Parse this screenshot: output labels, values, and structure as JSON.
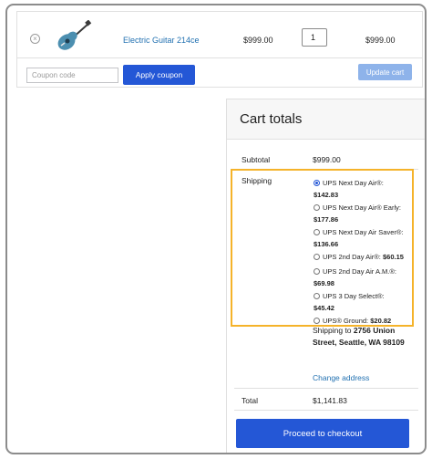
{
  "cart": {
    "remove_icon": "×",
    "product_image_icon": "guitar-thumbnail",
    "product_name": "Electric Guitar 214ce",
    "price": "$999.00",
    "quantity": "1",
    "line_subtotal": "$999.00"
  },
  "coupon": {
    "placeholder": "Coupon code",
    "apply_label": "Apply coupon",
    "update_label": "Update cart"
  },
  "totals": {
    "title": "Cart totals",
    "subtotal_label": "Subtotal",
    "subtotal_value": "$999.00",
    "shipping_label": "Shipping",
    "shipping_options": [
      {
        "name": "UPS Next Day Air®:",
        "price": "$142.83",
        "selected": true
      },
      {
        "name": "UPS Next Day Air® Early:",
        "price": "$177.86",
        "selected": false
      },
      {
        "name": "UPS Next Day Air Saver®:",
        "price": "$136.66",
        "selected": false
      },
      {
        "name": "UPS 2nd Day Air®:",
        "price": "$60.15",
        "selected": false
      },
      {
        "name": "UPS 2nd Day Air A.M.®:",
        "price": "$69.98",
        "selected": false
      },
      {
        "name": "UPS 3 Day Select®:",
        "price": "$45.42",
        "selected": false
      },
      {
        "name": "UPS® Ground:",
        "price": "$20.82",
        "selected": false
      }
    ],
    "shipping_to_prefix": "Shipping to",
    "shipping_address": "2756 Union Street, Seattle, WA 98109",
    "change_address": "Change address",
    "total_label": "Total",
    "total_value": "$1,141.83",
    "checkout_label": "Proceed to checkout"
  },
  "colors": {
    "accent": "#2457d6",
    "link": "#2271b1",
    "highlight_border": "#f5b32a"
  }
}
